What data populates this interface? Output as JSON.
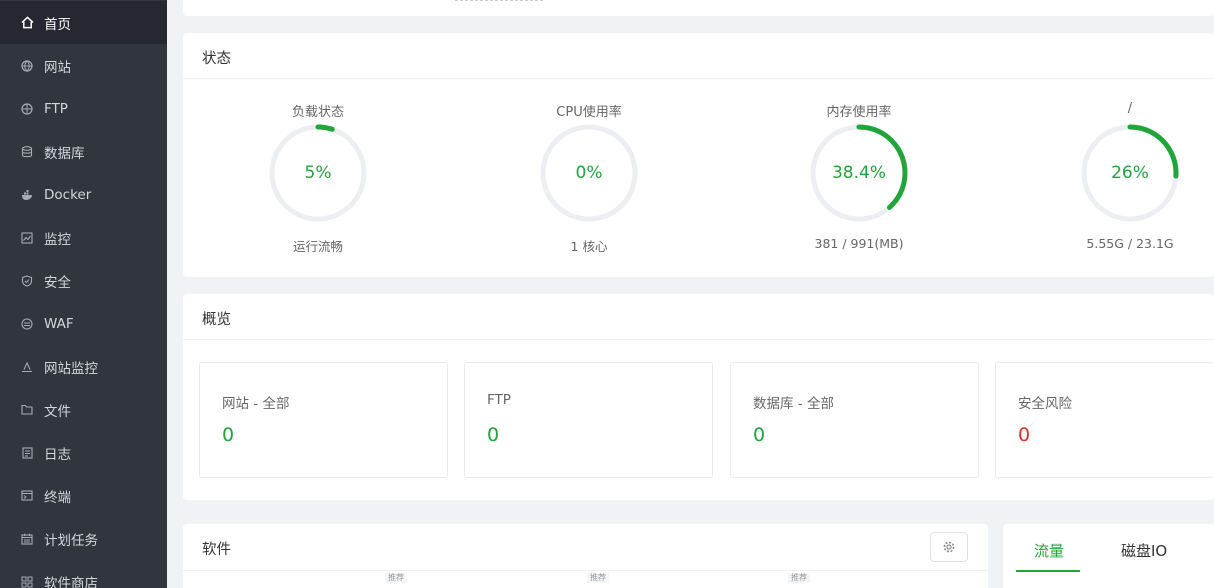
{
  "sidebar": {
    "items": [
      {
        "label": "首页",
        "icon": "home-icon"
      },
      {
        "label": "网站",
        "icon": "globe-icon"
      },
      {
        "label": "FTP",
        "icon": "ftp-globe-icon"
      },
      {
        "label": "数据库",
        "icon": "database-icon"
      },
      {
        "label": "Docker",
        "icon": "docker-icon"
      },
      {
        "label": "监控",
        "icon": "monitor-chart-icon"
      },
      {
        "label": "安全",
        "icon": "shield-icon"
      },
      {
        "label": "WAF",
        "icon": "waf-icon"
      },
      {
        "label": "网站监控",
        "icon": "site-monitor-icon"
      },
      {
        "label": "文件",
        "icon": "folder-icon"
      },
      {
        "label": "日志",
        "icon": "log-icon"
      },
      {
        "label": "终端",
        "icon": "terminal-icon"
      },
      {
        "label": "计划任务",
        "icon": "calendar-icon"
      },
      {
        "label": "软件商店",
        "icon": "store-grid-icon"
      }
    ],
    "active_index": 0
  },
  "status": {
    "title": "状态",
    "gauges": [
      {
        "title": "负载状态",
        "value": "5%",
        "percent": 5,
        "sub": "运行流畅"
      },
      {
        "title": "CPU使用率",
        "value": "0%",
        "percent": 0,
        "sub": "1 核心"
      },
      {
        "title": "内存使用率",
        "value": "38.4%",
        "percent": 38.4,
        "sub": "381 / 991(MB)"
      },
      {
        "title": "/",
        "value": "26%",
        "percent": 26,
        "sub": "5.55G / 23.1G"
      }
    ]
  },
  "overview": {
    "title": "概览",
    "tiles": [
      {
        "label": "网站 - 全部",
        "value": "0"
      },
      {
        "label": "FTP",
        "value": "0"
      },
      {
        "label": "数据库 - 全部",
        "value": "0"
      },
      {
        "label": "安全风险",
        "value": "0"
      }
    ]
  },
  "software": {
    "title": "软件",
    "recommend_tag": "推荐"
  },
  "traffic": {
    "tabs": [
      "流量",
      "磁盘IO"
    ],
    "active_tab": 0
  },
  "colors": {
    "accent": "#20a53a",
    "danger": "#d9302c",
    "sidebar_bg": "#31353d",
    "track": "#eceef2"
  }
}
